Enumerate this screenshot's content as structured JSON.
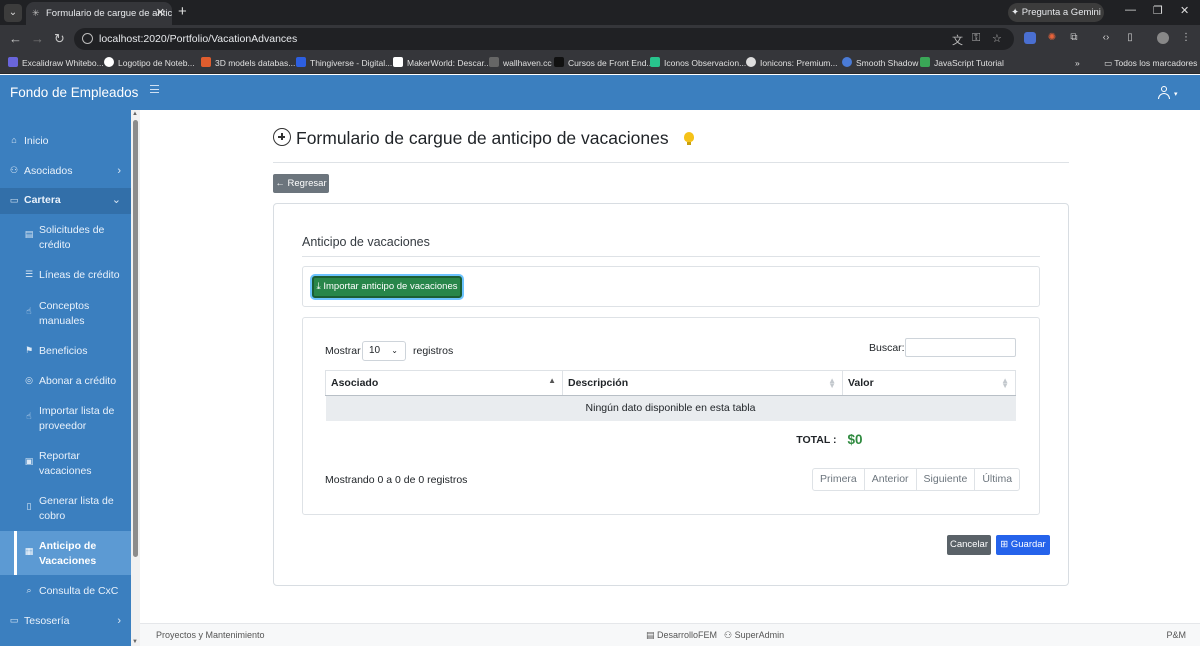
{
  "browser": {
    "tab_title": "Formulario de cargue de anticipo",
    "tab_close": "✕",
    "new_tab": "+",
    "gemini": "✦ Pregunta a Gemini",
    "url": "localhost:2020/Portfolio/VacationAdvances",
    "bookmarks": [
      {
        "label": "Excalidraw Whitebo...",
        "color": "#6965db"
      },
      {
        "label": "Logotipo de Noteb...",
        "color": "#ffffff"
      },
      {
        "label": "3D models databas...",
        "color": "#e05d2e"
      },
      {
        "label": "Thingiverse - Digital...",
        "color": "#2d5fe0"
      },
      {
        "label": "MakerWorld: Descar...",
        "color": "#ffffff"
      },
      {
        "label": "wallhaven.cc",
        "color": "#444444"
      },
      {
        "label": "Cursos de Front End...",
        "color": "#222222"
      },
      {
        "label": "Iconos Observacion...",
        "color": "#28c48d"
      },
      {
        "label": "Ionicons: Premium...",
        "color": "#ffffff"
      },
      {
        "label": "Smooth Shadow",
        "color": "#4a7bd6"
      },
      {
        "label": "JavaScript Tutorial",
        "color": "#3aa757"
      }
    ],
    "bookmarks_more": "»",
    "all_bookmarks": "Todos los marcadores"
  },
  "app": {
    "brand": "Fondo de Empleados"
  },
  "sidebar": {
    "items": [
      {
        "label": "Inicio"
      },
      {
        "label": "Asociados"
      },
      {
        "label": "Cartera"
      },
      {
        "label": "Solicitudes de",
        "label2": "crédito"
      },
      {
        "label": "Líneas de crédito"
      },
      {
        "label": "Conceptos",
        "label2": "manuales"
      },
      {
        "label": "Beneficios"
      },
      {
        "label": "Abonar a crédito"
      },
      {
        "label": "Importar lista de",
        "label2": "proveedor"
      },
      {
        "label": "Reportar",
        "label2": "vacaciones"
      },
      {
        "label": "Generar lista de",
        "label2": "cobro"
      },
      {
        "label": "Anticipo de",
        "label2": "Vacaciones"
      },
      {
        "label": "Consulta de CxC"
      },
      {
        "label": "Tesosería"
      }
    ]
  },
  "main": {
    "title": "Formulario de cargue de anticipo de vacaciones",
    "back_label": "← Regresar",
    "card_heading": "Anticipo de vacaciones",
    "import_label": "⤓ Importar anticipo de vacaciones",
    "table": {
      "show_label": "Mostrar",
      "page_size": "10",
      "records_label": "registros",
      "search_label": "Buscar:",
      "columns": [
        "Asociado",
        "Descripción",
        "Valor"
      ],
      "empty_text": "Ningún dato disponible en esta tabla",
      "total_label": "TOTAL :",
      "total_value": "$0",
      "info": "Mostrando 0 a 0 de 0 registros",
      "pager": [
        "Primera",
        "Anterior",
        "Siguiente",
        "Última"
      ]
    },
    "cancel_label": "Cancelar",
    "save_label": "Guardar"
  },
  "footer": {
    "left": "Proyectos y Mantenimiento",
    "db": "DesarrolloFEM",
    "user": "SuperAdmin",
    "right": "P&M"
  }
}
